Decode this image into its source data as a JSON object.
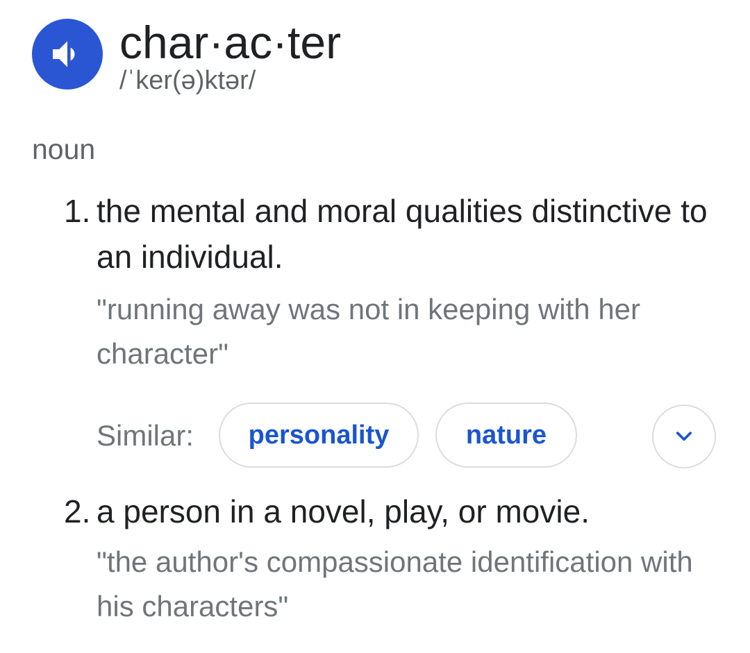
{
  "entry": {
    "word": "char·ac·ter",
    "pronunciation": "/ˈker(ə)ktər/",
    "audio_icon": "speaker-icon",
    "part_of_speech": "noun"
  },
  "senses": [
    {
      "number": "1.",
      "definition": "the mental and moral qualities distinctive to an individual.",
      "example": "\"running away was not in keeping with her character\"",
      "similar": {
        "label": "Similar:",
        "chips": [
          "personality",
          "nature"
        ],
        "expand_icon": "chevron-down-icon"
      }
    },
    {
      "number": "2.",
      "definition": "a person in a novel, play, or movie.",
      "example": "\"the author's compassionate identification with his characters\""
    }
  ],
  "colors": {
    "accent": "#2a56d3",
    "chip_text": "#1a55d0",
    "primary_text": "#202124",
    "secondary_text": "#70757a"
  }
}
